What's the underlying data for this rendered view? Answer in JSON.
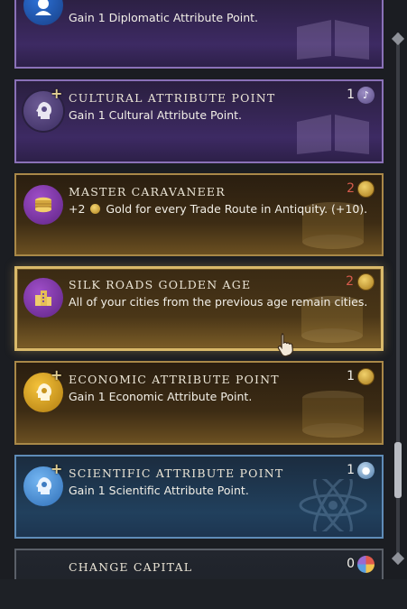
{
  "cards": [
    {
      "id": "diplomatic",
      "description": "Gain 1 Diplomatic Attribute Point."
    },
    {
      "id": "cultural",
      "title": "CULTURAL ATTRIBUTE POINT",
      "description": "Gain 1 Cultural Attribute Point.",
      "cost": "1",
      "resource_icon": "music-note-icon"
    },
    {
      "id": "master-caravaneer",
      "title": "MASTER CARAVANEER",
      "desc_prefix": "+2",
      "desc_suffix": "Gold for every Trade Route in Antiquity. (+10).",
      "cost": "2",
      "resource_icon": "gold-coin-icon"
    },
    {
      "id": "silk-roads",
      "title": "SILK ROADS GOLDEN AGE",
      "description": "All of your cities from the previous age remain cities.",
      "cost": "2",
      "resource_icon": "gold-coin-icon",
      "selected": true
    },
    {
      "id": "economic",
      "title": "ECONOMIC ATTRIBUTE POINT",
      "description": "Gain 1 Economic Attribute Point.",
      "cost": "1",
      "resource_icon": "gold-coin-icon"
    },
    {
      "id": "scientific",
      "title": "SCIENTIFIC ATTRIBUTE POINT",
      "description": "Gain 1 Scientific Attribute Point.",
      "cost": "1",
      "resource_icon": "science-flask-icon"
    },
    {
      "id": "change-capital",
      "title": "CHANGE CAPITAL",
      "cost": "0",
      "resource_icon": "multi-yield-icon"
    }
  ],
  "colors": {
    "cultural_border": "#8a71b8",
    "gold_border": "#a98848",
    "selected_border": "#d9b96a",
    "scientific_border": "#5f8cb8",
    "insufficient_cost": "#d65b4c"
  }
}
